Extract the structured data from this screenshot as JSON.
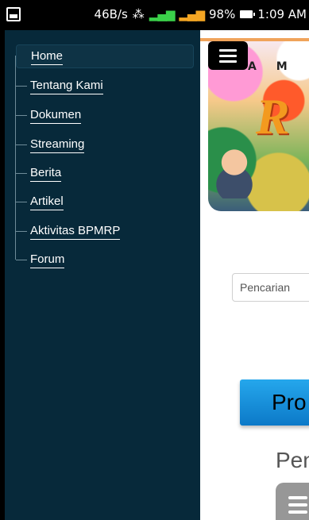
{
  "status_bar": {
    "net_speed": "46B/s",
    "battery": "98%",
    "time": "1:09 AM"
  },
  "sidebar": {
    "items": [
      {
        "label": "Home",
        "active": true
      },
      {
        "label": "Tentang Kami"
      },
      {
        "label": "Dokumen"
      },
      {
        "label": "Streaming"
      },
      {
        "label": "Berita"
      },
      {
        "label": "Artikel"
      },
      {
        "label": "Aktivitas BPMRP"
      },
      {
        "label": "Forum"
      }
    ]
  },
  "main": {
    "banner_letters": "A M",
    "banner_big_letter": "R",
    "search_placeholder": "Pencarian",
    "pro_heading": "Pro",
    "section_heading": "Pen"
  },
  "colors": {
    "sidebar_bg": "#07293a",
    "accent_blue": "#0c79c8"
  }
}
